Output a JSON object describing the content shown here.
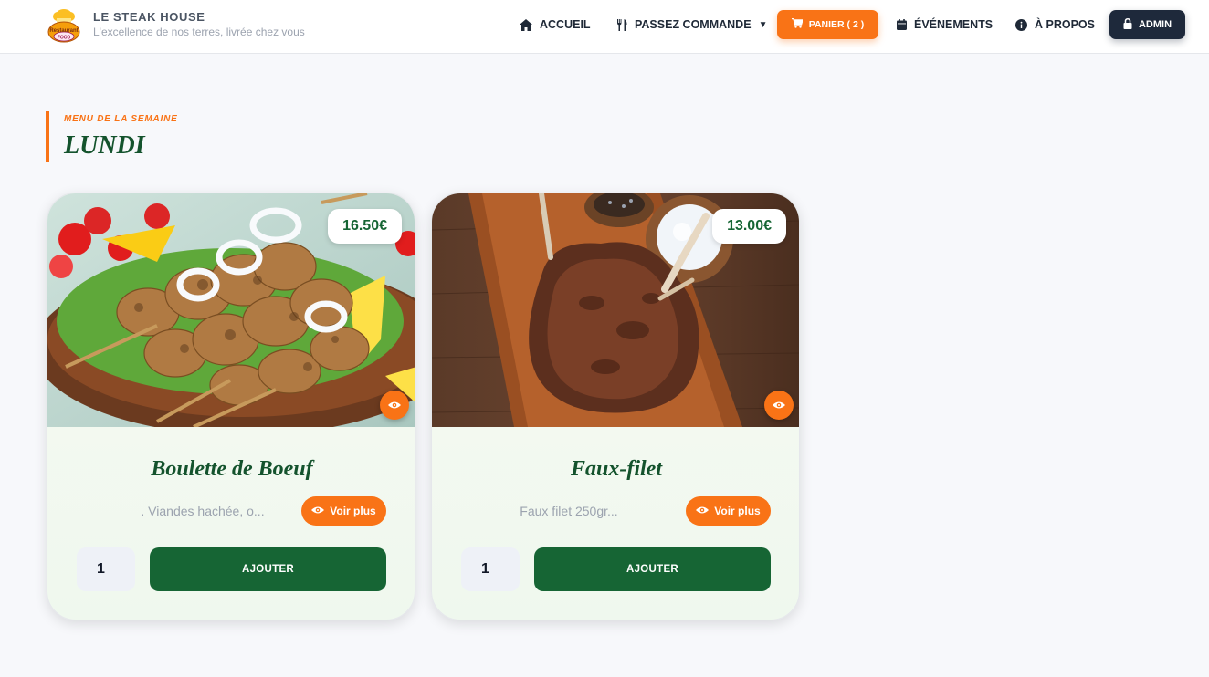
{
  "brand": {
    "title": "LE STEAK HOUSE",
    "subtitle": "L'excellence de nos terres, livrée chez vous",
    "logo_text_top": "Restaurant",
    "logo_text_bottom": "FOOD"
  },
  "nav": {
    "home": {
      "label": "ACCUEIL",
      "icon": "home-icon"
    },
    "order": {
      "label": "PASSEZ COMMANDE",
      "icon": "cutlery-icon",
      "caret": "▼"
    },
    "cart": {
      "label": "PANIER ( 2 )",
      "icon": "cart-icon"
    },
    "events": {
      "label": "ÉVÉNEMENTS",
      "icon": "calendar-icon"
    },
    "about": {
      "label": "À PROPOS",
      "icon": "info-icon"
    },
    "admin": {
      "label": "ADMIN",
      "icon": "lock-icon"
    }
  },
  "section": {
    "kicker": "MENU DE LA SEMAINE",
    "title": "LUNDI"
  },
  "products": [
    {
      "name": "Boulette de Boeuf",
      "price": "16.50€",
      "description": ". Viandes hachée, o...",
      "more_label": "Voir plus",
      "quantity": "1",
      "add_label": "AJOUTER",
      "image": "grilled-chicken-skewers"
    },
    {
      "name": "Faux-filet",
      "price": "13.00€",
      "description": "Faux filet 250gr...",
      "more_label": "Voir plus",
      "quantity": "1",
      "add_label": "AJOUTER",
      "image": "grilled-beef-steak"
    }
  ],
  "colors": {
    "accent": "#f97316",
    "primary_green": "#166534",
    "dark": "#1e293b",
    "background": "#f7f8fb"
  }
}
